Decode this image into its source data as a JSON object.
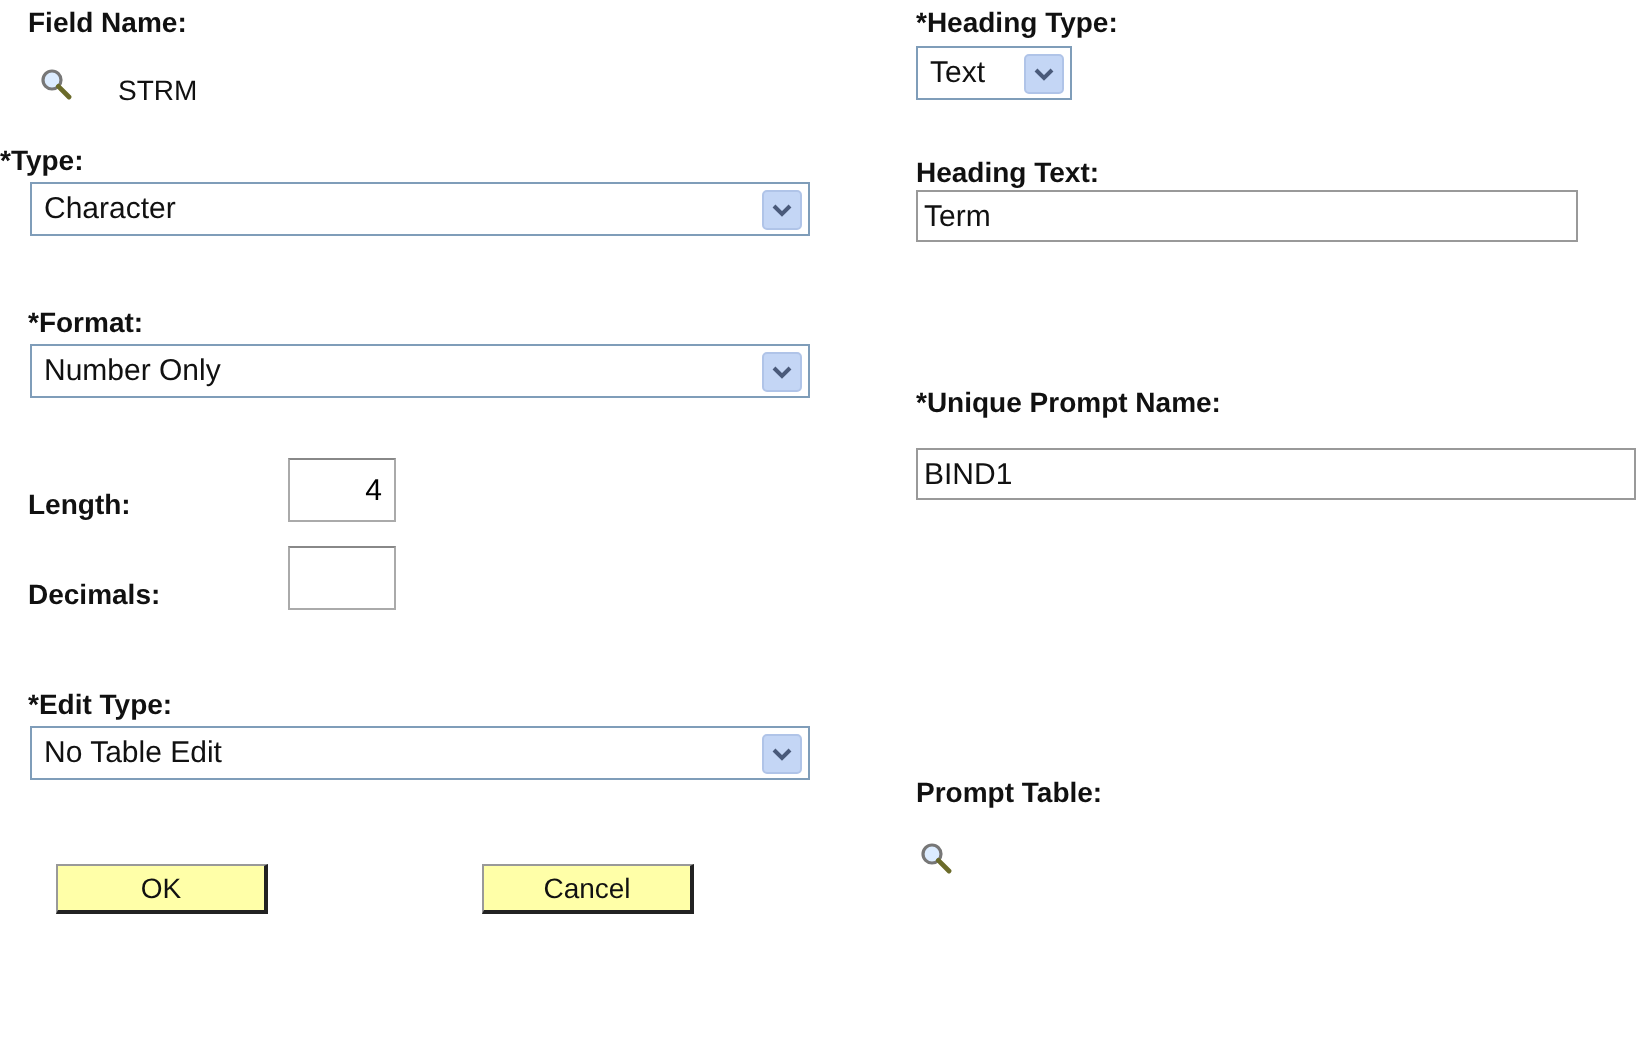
{
  "field_name": {
    "label": "Field Name:",
    "value": "STRM"
  },
  "type": {
    "label": "*Type:",
    "value": "Character"
  },
  "format": {
    "label": "*Format:",
    "value": "Number Only"
  },
  "length": {
    "label": "Length:",
    "value": "4"
  },
  "decimals": {
    "label": "Decimals:"
  },
  "edit_type": {
    "label": "*Edit Type:",
    "value": "No Table Edit"
  },
  "heading_type": {
    "label": "*Heading Type:",
    "value": "Text"
  },
  "heading_text": {
    "label": "Heading Text:",
    "value": "Term"
  },
  "unique_prompt_name": {
    "label": "*Unique Prompt Name:",
    "value": "BIND1"
  },
  "prompt_table": {
    "label": "Prompt Table:"
  },
  "buttons": [
    "OK",
    "Cancel"
  ]
}
